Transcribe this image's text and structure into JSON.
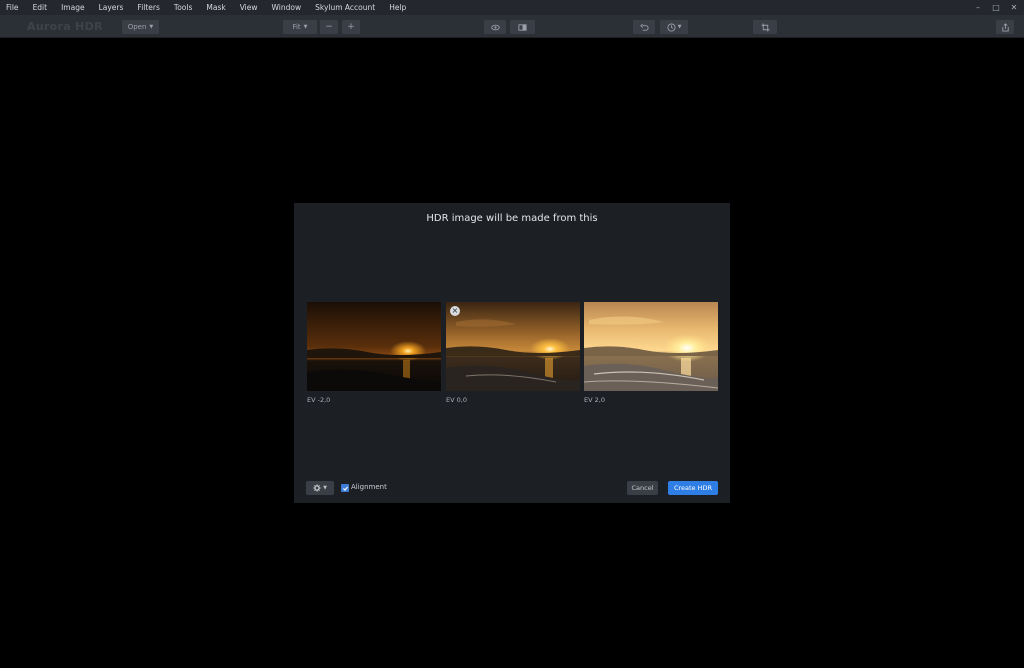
{
  "menu": {
    "items": [
      "File",
      "Edit",
      "Image",
      "Layers",
      "Filters",
      "Tools",
      "Mask",
      "View",
      "Window",
      "Skylum Account",
      "Help"
    ]
  },
  "toolbar": {
    "logo": "Aurora HDR",
    "open_label": "Open",
    "zoom_label": "Fit",
    "zoom_out": "−",
    "zoom_in": "+"
  },
  "dialog": {
    "title": "HDR image will be made from this",
    "thumbnails": [
      {
        "ev": "EV -2,0",
        "exposure": "dark"
      },
      {
        "ev": "EV 0,0",
        "exposure": "normal"
      },
      {
        "ev": "EV 2,0",
        "exposure": "bright"
      }
    ],
    "alignment_label": "Alignment",
    "alignment_checked": true,
    "cancel_label": "Cancel",
    "create_label": "Create HDR"
  }
}
